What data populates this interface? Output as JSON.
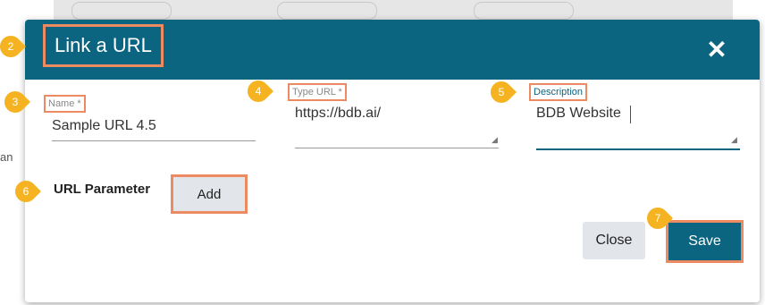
{
  "dialog": {
    "title": "Link a URL",
    "close_icon": "close-icon"
  },
  "fields": {
    "name": {
      "label": "Name *",
      "value": "Sample URL 4.5"
    },
    "type_url": {
      "label": "Type URL *",
      "value": "https://bdb.ai/"
    },
    "description": {
      "label": "Description",
      "value": "BDB Website"
    }
  },
  "url_parameter": {
    "label": "URL Parameter",
    "add_label": "Add"
  },
  "buttons": {
    "close_label": "Close",
    "save_label": "Save"
  },
  "callouts": [
    "2",
    "3",
    "4",
    "5",
    "6",
    "7"
  ],
  "background_fragment": "an",
  "colors": {
    "header": "#0b6580",
    "highlight": "#ec8b62",
    "callout": "#f5b321",
    "button_gray": "#e2e5e9"
  }
}
